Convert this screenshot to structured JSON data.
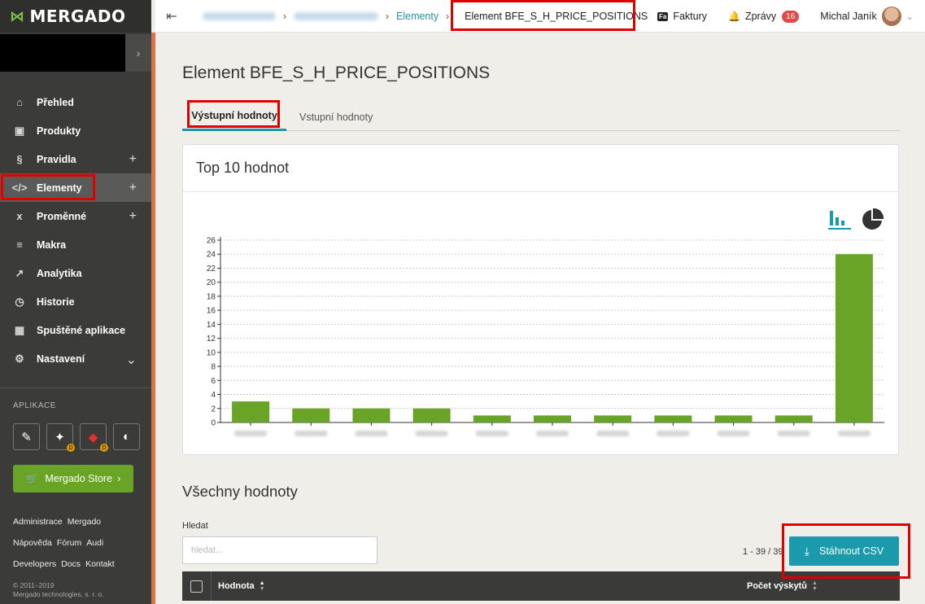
{
  "brand": {
    "name": "MERGADO"
  },
  "sidebar": {
    "items": [
      {
        "label": "Přehled",
        "icon": "home-icon",
        "glyph": "⌂",
        "plus": ""
      },
      {
        "label": "Produkty",
        "icon": "box-icon",
        "glyph": "▣",
        "plus": ""
      },
      {
        "label": "Pravidla",
        "icon": "section-icon",
        "glyph": "§",
        "plus": "+"
      },
      {
        "label": "Elementy",
        "icon": "code-icon",
        "glyph": "</>",
        "plus": "+"
      },
      {
        "label": "Proměnné",
        "icon": "variable-icon",
        "glyph": "x",
        "plus": "+"
      },
      {
        "label": "Makra",
        "icon": "macro-icon",
        "glyph": "≡",
        "plus": ""
      },
      {
        "label": "Analytika",
        "icon": "analytics-icon",
        "glyph": "↗",
        "plus": ""
      },
      {
        "label": "Historie",
        "icon": "history-icon",
        "glyph": "◷",
        "plus": ""
      },
      {
        "label": "Spuštěné aplikace",
        "icon": "apps-grid-icon",
        "glyph": "▦",
        "plus": ""
      },
      {
        "label": "Nastavení",
        "icon": "gear-icon",
        "glyph": "⚙",
        "plus": "⌄"
      }
    ],
    "apps_title": "APLIKACE",
    "store_label": "Mergado Store",
    "footer_links": {
      "administrace": "Administrace",
      "mergado": "Mergado",
      "napoveda": "Nápověda",
      "forum": "Fórum",
      "audi": "Audi",
      "developers": "Developers",
      "docs": "Docs",
      "kontakt": "Kontakt"
    },
    "copyright_line1": "© 2011–2019",
    "copyright_line2": "Mergado technologies, s. r. o."
  },
  "topbar": {
    "crumb_elementy": "Elementy",
    "crumb_current": "Element BFE_S_H_PRICE_POSITIONS",
    "faktury_badge": "Fa",
    "faktury": "Faktury",
    "zpravy": "Zprávy",
    "zpravy_count": "16",
    "user": "Michal Janík"
  },
  "main": {
    "title": "Element BFE_S_H_PRICE_POSITIONS",
    "tab_active": "Výstupní hodnoty",
    "tab_inactive": "Vstupní hodnoty",
    "card_title": "Top 10 hodnot",
    "all_values_title": "Všechny hodnoty",
    "search_label": "Hledat",
    "search_placeholder": "hledat...",
    "pager": "1 - 39 / 39",
    "csv_label": "Stáhnout CSV",
    "col_value": "Hodnota",
    "col_count": "Počet výskytů"
  },
  "colors": {
    "accent": "#2a8fa8",
    "bar": "#6aa426",
    "highlight": "#e00000",
    "sidebar": "#3b3b39"
  },
  "chart_data": {
    "type": "bar",
    "categories": [
      "",
      "",
      "",
      "",
      "",
      "",
      "",
      "",
      "",
      "",
      ""
    ],
    "values": [
      3,
      2,
      2,
      2,
      1,
      1,
      1,
      1,
      1,
      1,
      24
    ],
    "ylim": [
      0,
      26
    ],
    "yticks": [
      0,
      2,
      4,
      6,
      8,
      10,
      12,
      14,
      16,
      18,
      20,
      22,
      24,
      26
    ],
    "grid": true,
    "legend": "none"
  }
}
